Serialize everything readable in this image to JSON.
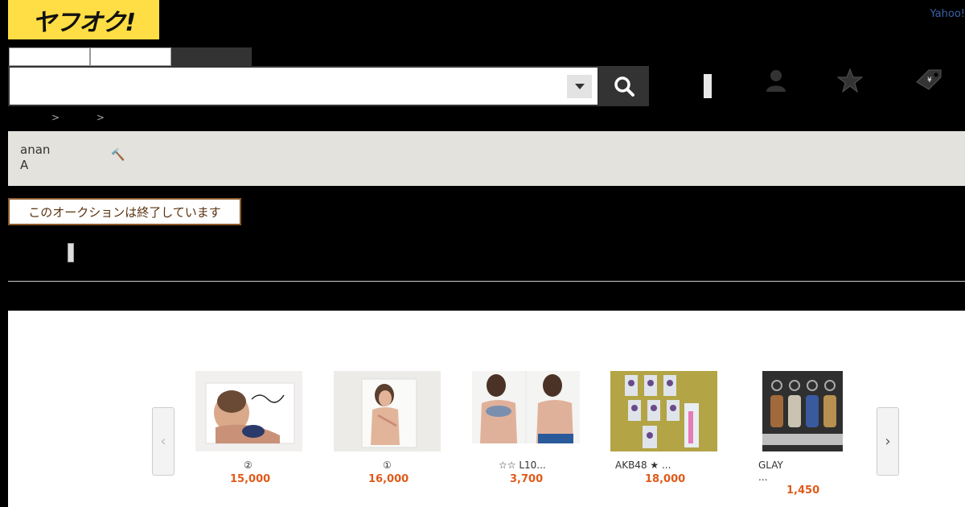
{
  "header": {
    "logo_text": "ヤフオク!",
    "yahoo_link": "Yahoo!",
    "search": {
      "value": "",
      "placeholder": ""
    }
  },
  "breadcrumb": [
    ">",
    ">"
  ],
  "auction": {
    "title_lines": [
      "anan",
      "A"
    ],
    "ended_label": "このオークションは終了しています"
  },
  "recommendations": {
    "items": [
      {
        "title": "②",
        "price": "15,000"
      },
      {
        "title": "①",
        "price": "16,000"
      },
      {
        "title": "☆☆ L10...",
        "price": "3,700"
      },
      {
        "title": "AKB48 ★ ...",
        "price": "18,000"
      },
      {
        "title": "GLAY\n...",
        "price": "1,450"
      }
    ],
    "prev_label": "‹",
    "next_label": "›"
  },
  "colors": {
    "logo_bg": "#ffdd44",
    "price": "#e05a1a",
    "ended_border": "#8b5a2b"
  }
}
